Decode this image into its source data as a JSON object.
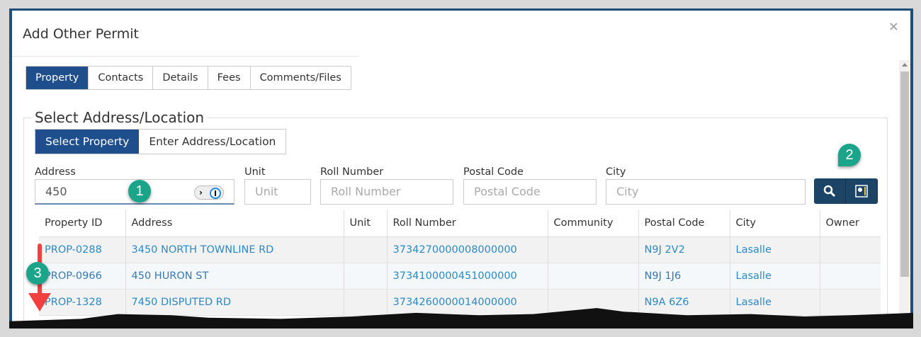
{
  "modal": {
    "title": "Add Other Permit",
    "close": "×"
  },
  "tabs": [
    "Property",
    "Contacts",
    "Details",
    "Fees",
    "Comments/Files"
  ],
  "section": {
    "title": "Select Address/Location",
    "subtabs": [
      "Select Property",
      "Enter Address/Location"
    ]
  },
  "search": {
    "address_label": "Address",
    "address_value": "450",
    "unit_label": "Unit",
    "unit_placeholder": "Unit",
    "roll_label": "Roll Number",
    "roll_placeholder": "Roll Number",
    "postal_label": "Postal Code",
    "postal_placeholder": "Postal Code",
    "city_label": "City",
    "city_placeholder": "City"
  },
  "table": {
    "headers": [
      "Property ID",
      "Address",
      "Unit",
      "Roll Number",
      "Community",
      "Postal Code",
      "City",
      "Owner"
    ],
    "rows": [
      [
        "PROP-0288",
        "3450 NORTH TOWNLINE RD",
        "",
        "3734270000008000000",
        "",
        "N9J 2V2",
        "Lasalle",
        ""
      ],
      [
        "PROP-0966",
        "450 HURON ST",
        "",
        "3734100000451000000",
        "",
        "N9J 1J6",
        "Lasalle",
        ""
      ],
      [
        "PROP-1328",
        "7450 DISPUTED RD",
        "",
        "3734260000014000000",
        "",
        "N9A 6Z6",
        "Lasalle",
        ""
      ]
    ]
  },
  "callouts": [
    "1",
    "2",
    "3"
  ],
  "colors": {
    "primary": "#1e4e8c",
    "callout": "#1aa58a",
    "arrow": "#f04040"
  }
}
